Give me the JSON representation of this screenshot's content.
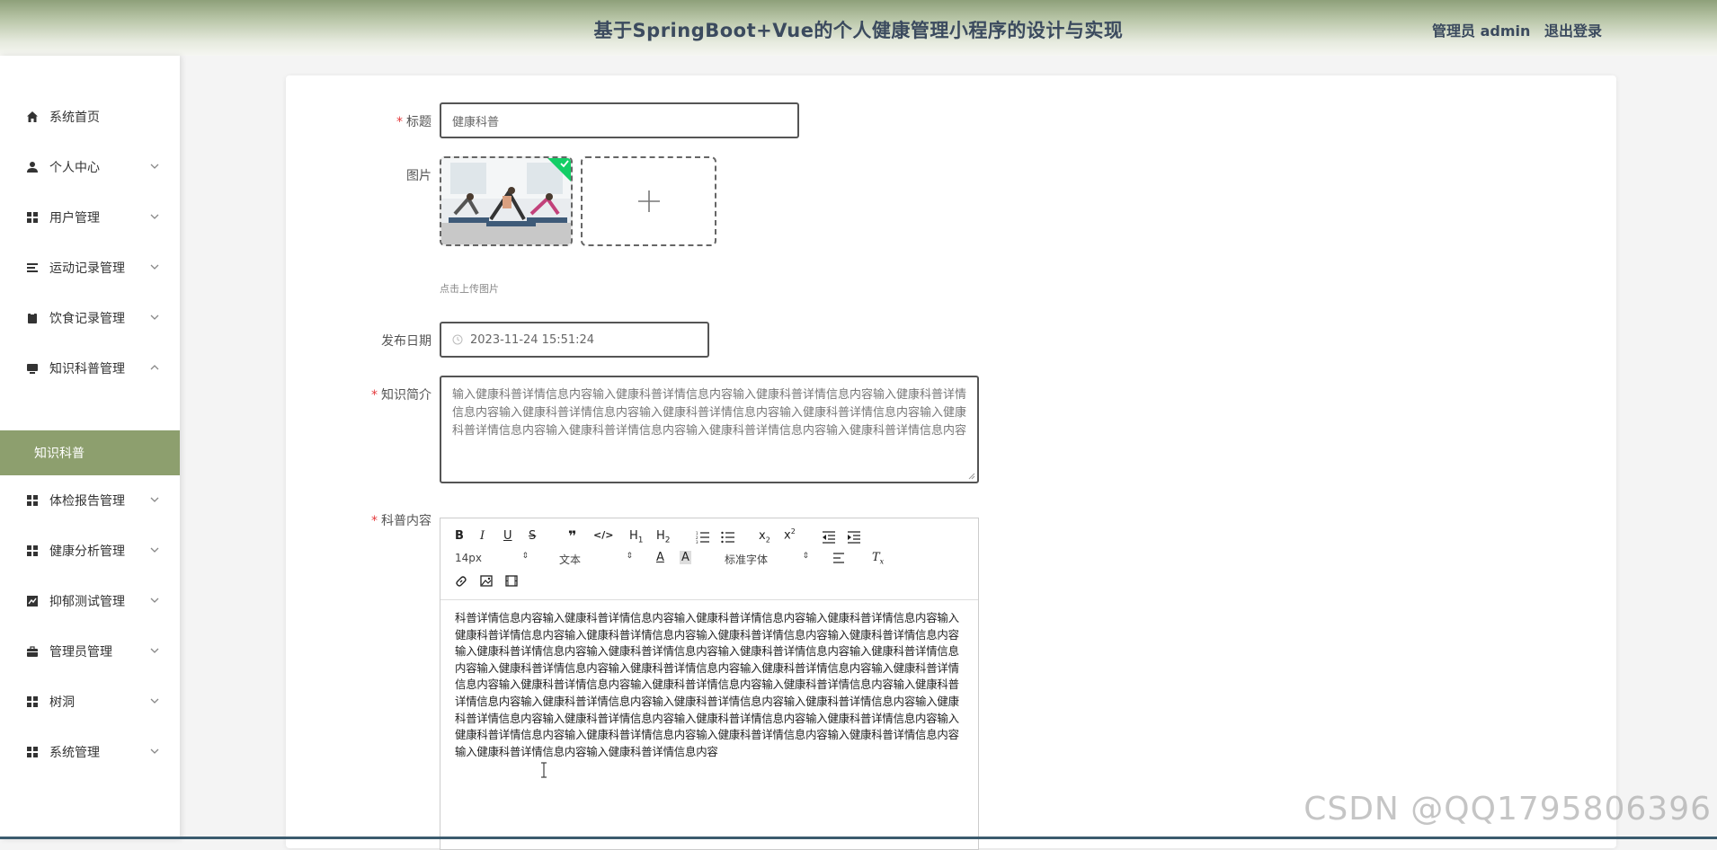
{
  "header": {
    "title": "基于SpringBoot+Vue的个人健康管理小程序的设计与实现",
    "user_label": "管理员 admin",
    "logout_label": "退出登录"
  },
  "sidebar": {
    "items": [
      {
        "label": "系统首页",
        "icon": "home-icon"
      },
      {
        "label": "个人中心",
        "icon": "user-icon"
      },
      {
        "label": "用户管理",
        "icon": "grid-icon"
      },
      {
        "label": "运动记录管理",
        "icon": "list-icon"
      },
      {
        "label": "饮食记录管理",
        "icon": "clipboard-icon"
      },
      {
        "label": "知识科普管理",
        "icon": "monitor-icon"
      },
      {
        "label": "体检报告管理",
        "icon": "grid-icon"
      },
      {
        "label": "健康分析管理",
        "icon": "grid-icon"
      },
      {
        "label": "抑郁测试管理",
        "icon": "chart-icon"
      },
      {
        "label": "管理员管理",
        "icon": "briefcase-icon"
      },
      {
        "label": "树洞",
        "icon": "grid-icon"
      },
      {
        "label": "系统管理",
        "icon": "grid-icon"
      }
    ],
    "active_subitem": "知识科普",
    "accent": "#8d9f6e"
  },
  "form": {
    "title_label": "标题",
    "title_value": "健康科普",
    "image_label": "图片",
    "upload_tip": "点击上传图片",
    "date_label": "发布日期",
    "date_value": "2023-11-24 15:51:24",
    "summary_label": "知识简介",
    "summary_value": "输入健康科普详情信息内容输入健康科普详情信息内容输入健康科普详情信息内容输入健康科普详情信息内容输入健康科普详情信息内容输入健康科普详情信息内容输入健康科普详情信息内容输入健康科普详情信息内容输入健康科普详情信息内容输入健康科普详情信息内容输入健康科普详情信息内容",
    "content_label": "科普内容",
    "content_value": "科普详情信息内容输入健康科普详情信息内容输入健康科普详情信息内容输入健康科普详情信息内容输入健康科普详情信息内容输入健康科普详情信息内容输入健康科普详情信息内容输入健康科普详情信息内容输入健康科普详情信息内容输入健康科普详情信息内容输入健康科普详情信息内容输入健康科普详情信息内容输入健康科普详情信息内容输入健康科普详情信息内容输入健康科普详情信息内容输入健康科普详情信息内容输入健康科普详情信息内容输入健康科普详情信息内容输入健康科普详情信息内容输入健康科普详情信息内容输入健康科普详情信息内容输入健康科普详情信息内容输入健康科普详情信息内容输入健康科普详情信息内容输入健康科普详情信息内容输入健康科普详情信息内容输入健康科普详情信息内容输入健康科普详情信息内容输入健康科普详情信息内容输入健康科普详情信息内容输入健康科普详情信息内容输入健康科普详情信息内容输入健康科普详情信息内容"
  },
  "editor_toolbar": {
    "font_size": "14px",
    "block_type": "文本",
    "font_family": "标准字体"
  },
  "watermark": "CSDN @QQ1795806396"
}
